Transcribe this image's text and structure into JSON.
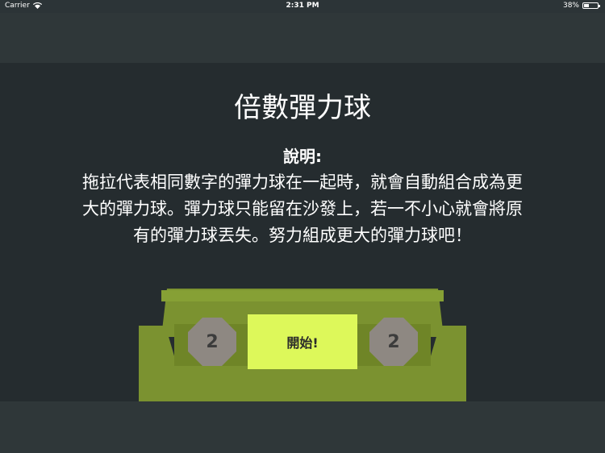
{
  "status_bar": {
    "carrier": "Carrier",
    "time": "2:31 PM",
    "battery_percent": "38%",
    "battery_level": 0.38,
    "wifi_icon": "wifi-icon",
    "battery_icon": "battery-icon"
  },
  "game": {
    "title": "倍數彈力球",
    "instructions_heading": "說明:",
    "instructions_lines": [
      "拖拉代表相同數字的彈力球在一起時，就會自動組合成為更",
      "大的彈力球。彈力球只能留在沙發上，若一不小心就會將原",
      "有的彈力球丟失。努力組成更大的彈力球吧！"
    ],
    "balls": [
      {
        "value": "2"
      },
      {
        "value": "2"
      }
    ],
    "start_label": "開始!"
  },
  "colors": {
    "background": "#2c3437",
    "panel": "#252c2f",
    "sofa": "#7b9230",
    "ball": "#8e8882",
    "start_button": "#ddf85a"
  }
}
